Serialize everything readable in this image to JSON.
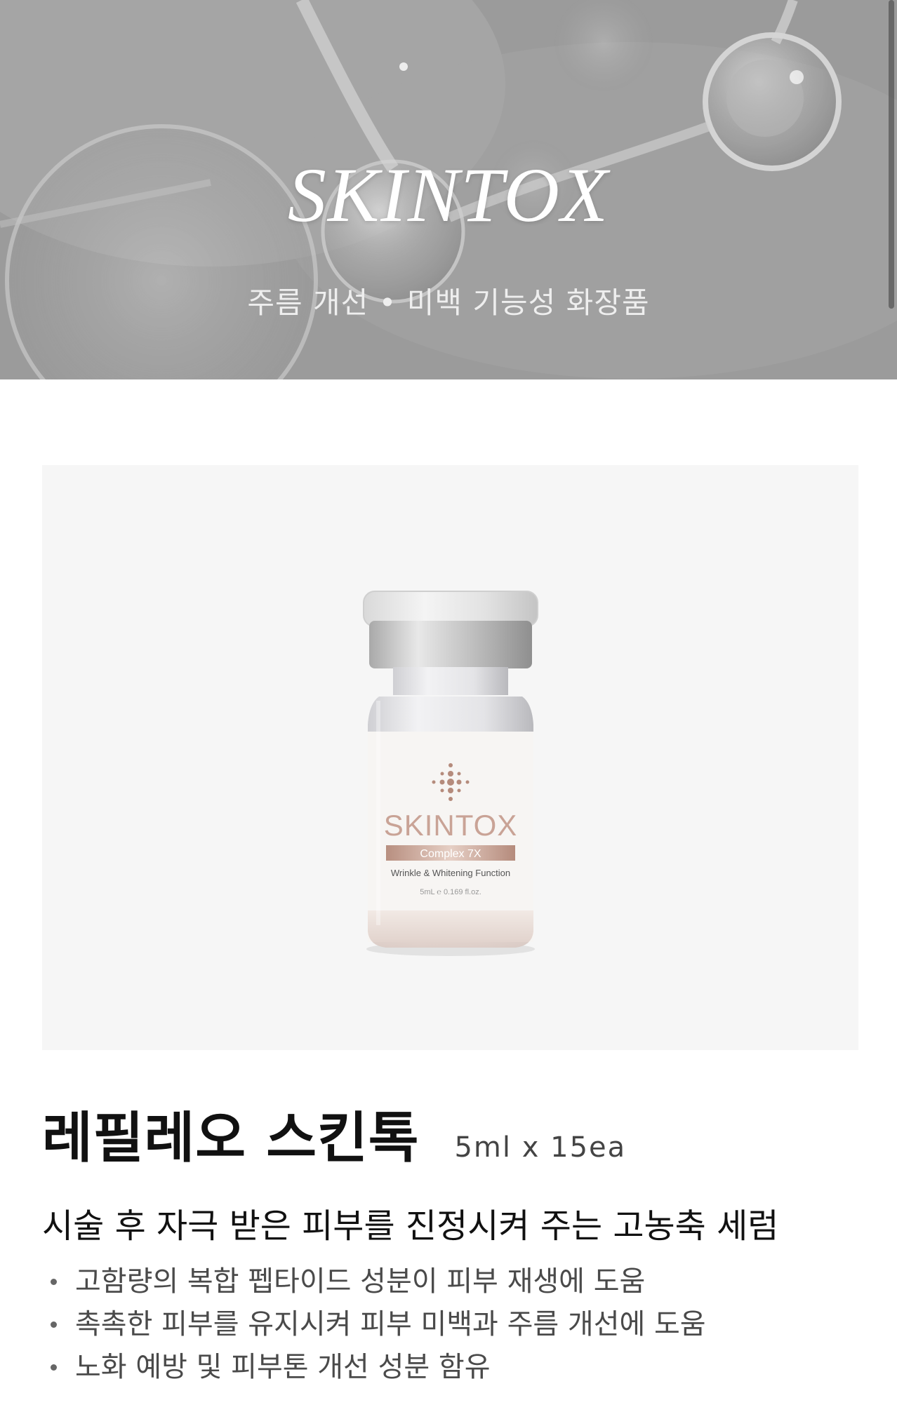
{
  "hero": {
    "title": "SKINTOX",
    "subtitle": "주름 개선 • 미백 기능성 화장품"
  },
  "product": {
    "label": {
      "brand": "SKINTOX",
      "line": "Complex 7X",
      "function": "Wrinkle & Whitening Function",
      "volume": "5mL ℮ 0.169 fl.oz."
    },
    "name": "레필레오 스킨톡",
    "spec": "5ml x 15ea",
    "headline": "시술 후 자극 받은 피부를 진정시켜 주는 고농축 세럼",
    "features": [
      "고함량의 복합 펩타이드 성분이 피부 재생에 도움",
      "촉촉한 피부를 유지시켜 피부 미백과 주름 개선에 도움",
      "노화 예방 및 피부톤 개선 성분 함유"
    ]
  },
  "colors": {
    "accent_rose_gold": "#c9a396",
    "hero_gray": "#9a9a9a",
    "panel_bg": "#f6f6f6"
  }
}
